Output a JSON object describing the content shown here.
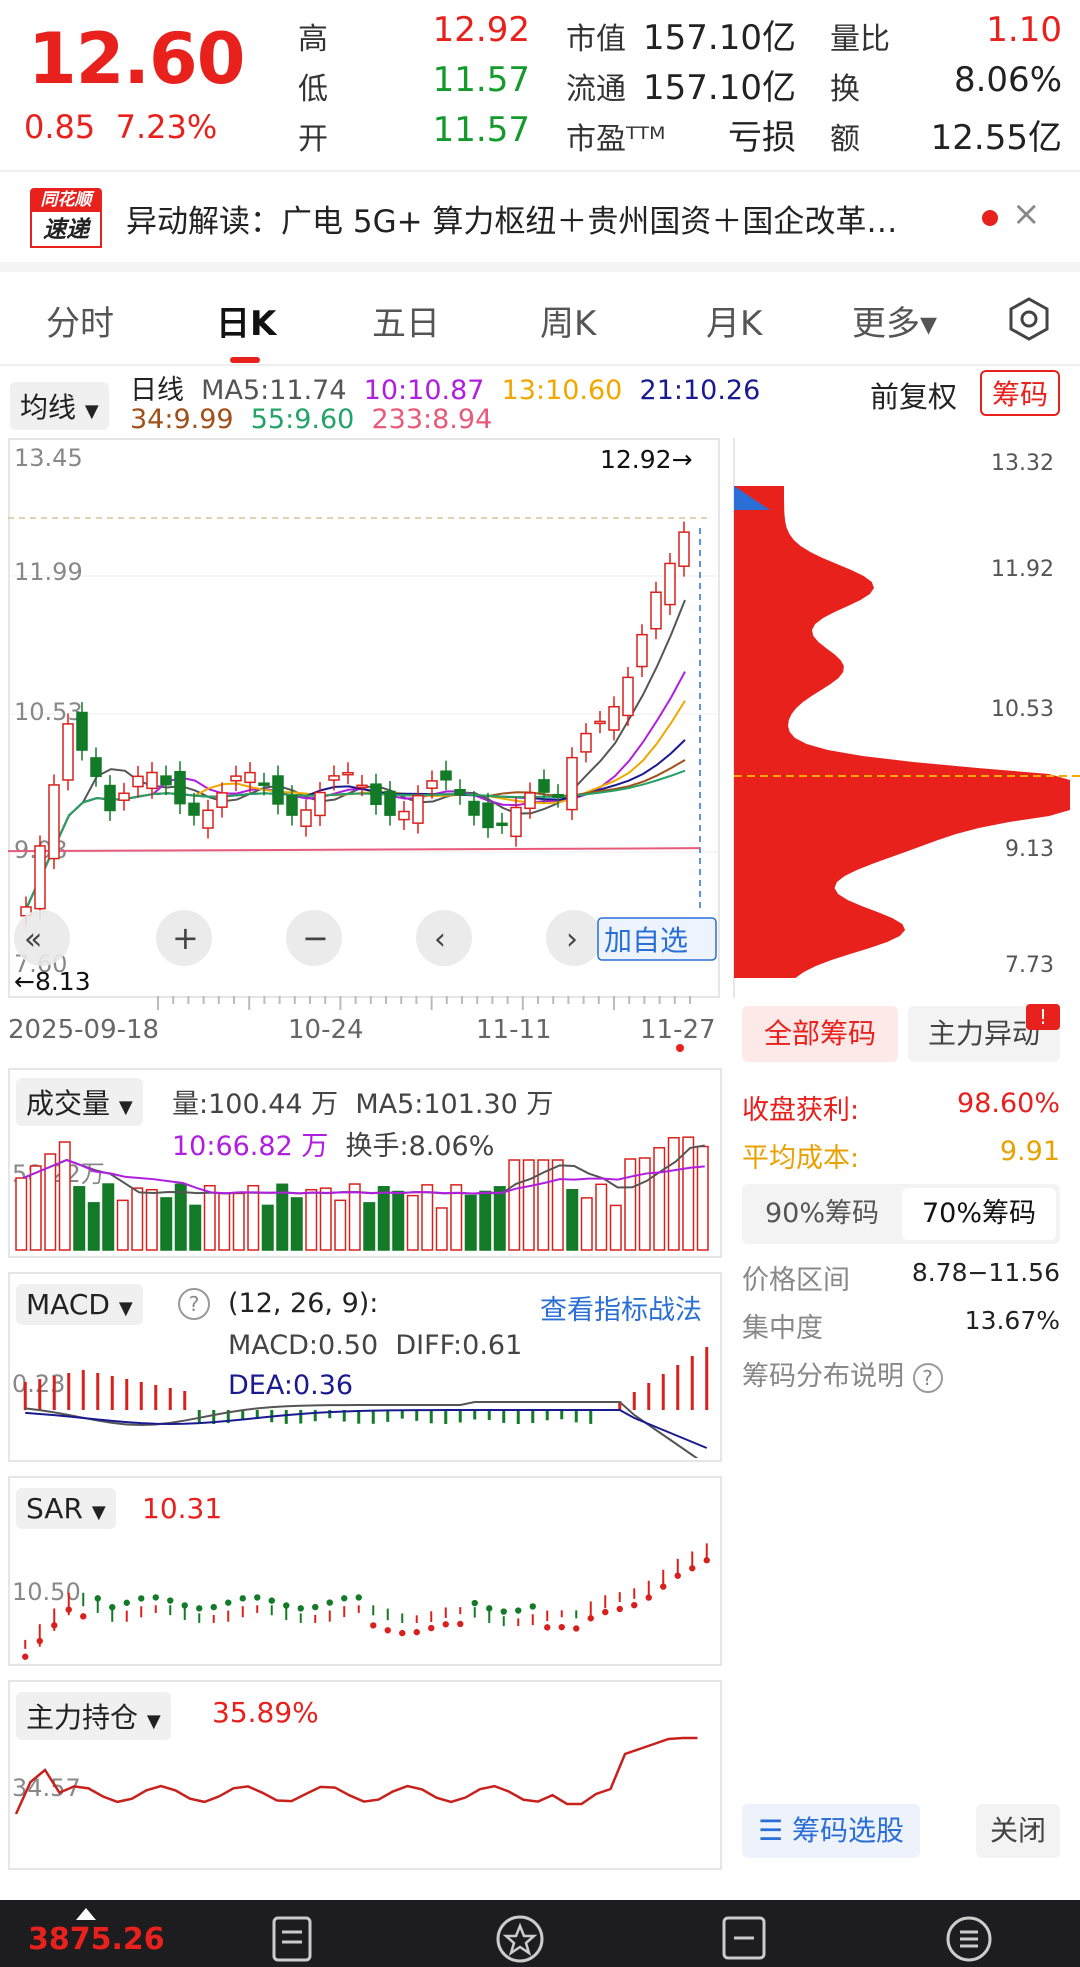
{
  "quote": {
    "price": "12.60",
    "change": "0.85",
    "change_pct": "7.23%",
    "stats": [
      {
        "label": "高",
        "value": "12.92",
        "color": "red"
      },
      {
        "label": "低",
        "value": "11.57",
        "color": "green"
      },
      {
        "label": "开",
        "value": "11.57",
        "color": "green"
      }
    ],
    "stats2": [
      {
        "label": "市值",
        "value": "157.10亿"
      },
      {
        "label": "流通",
        "value": "157.10亿"
      },
      {
        "label": "市盈ᵀᵀᴹ",
        "value": "亏损"
      }
    ],
    "stats3": [
      {
        "label": "量比",
        "value": "1.10",
        "color": "red"
      },
      {
        "label": "换",
        "value": "8.06%"
      },
      {
        "label": "额",
        "value": "12.55亿"
      }
    ]
  },
  "news": {
    "logo_top": "同花顺",
    "logo_bottom": "速递",
    "text": "异动解读：广电 5G+ 算力枢纽＋贵州国资＋国企改革…",
    "close": "×"
  },
  "tabs": [
    "分时",
    "日K",
    "五日",
    "周K",
    "月K",
    "更多▾"
  ],
  "tabs_active": 1,
  "ma_legend": {
    "dropdown": "均线",
    "items_row1": [
      {
        "text": "日线",
        "color": "#222222"
      },
      {
        "text": "MA5:11.74",
        "color": "#555555"
      },
      {
        "text": "10:10.87",
        "color": "#b01ee0"
      },
      {
        "text": "13:10.60",
        "color": "#f0a800"
      },
      {
        "text": "21:10.26",
        "color": "#1a1a90"
      }
    ],
    "items_row2": [
      {
        "text": "34:9.99",
        "color": "#a0501a"
      },
      {
        "text": "55:9.60",
        "color": "#23a368"
      },
      {
        "text": "233:8.94",
        "color": "#e85a7a"
      }
    ],
    "fq": "前复权",
    "chip_btn": "筹码"
  },
  "kchart": {
    "y_labels": [
      "13.45",
      "11.99",
      "10.53",
      "9.08",
      "7.60"
    ],
    "high_label": "12.92→",
    "low_label": "←8.13",
    "x_labels": [
      "2025-09-18",
      "10-24",
      "11-11",
      "11-27"
    ],
    "add_watch": "加自选"
  },
  "chip_axis": [
    "13.32",
    "11.92",
    "10.53",
    "9.13",
    "7.73"
  ],
  "chip_panel": {
    "tab_all": "全部筹码",
    "tab_main": "主力异动",
    "badge": "!",
    "profit_label": "收盘获利:",
    "profit_value": "98.60%",
    "cost_label": "平均成本:",
    "cost_value": "9.91",
    "seg_90": "90%筹码",
    "seg_70": "70%筹码",
    "range_label": "价格区间",
    "range_value": "8.78−11.56",
    "conc_label": "集中度",
    "conc_value": "13.67%",
    "explain": "筹码分布说明",
    "pick_btn": "筹码选股",
    "close_btn": "关闭"
  },
  "volume": {
    "dropdown": "成交量",
    "vol": "量:100.44 万",
    "ma5": "MA5:101.30 万",
    "ma10": "10:66.82 万",
    "turnover": "换手:8.06%",
    "y_label": "58.22万"
  },
  "macd": {
    "dropdown": "MACD",
    "params": "(12, 26, 9):",
    "link": "查看指标战法",
    "macd": "MACD:0.50",
    "diff": "DIFF:0.61",
    "dea": "DEA:0.36",
    "y_label": "0.23"
  },
  "sar": {
    "dropdown": "SAR",
    "value": "10.31",
    "y_label": "10.50"
  },
  "main_hold": {
    "dropdown": "主力持仓",
    "value": "35.89%",
    "y_label": "34.57"
  },
  "bottom_bar": {
    "index_value": "3875.26"
  },
  "icons": [
    "settings-hexagon-icon",
    "dropdown-arrow-icon",
    "zoom-in-icon",
    "zoom-out-icon",
    "pan-left-icon",
    "pan-right-icon",
    "fullscreen-icon",
    "help-circle-icon",
    "document-icon",
    "star-icon",
    "minus-box-icon",
    "menu-icon"
  ]
}
